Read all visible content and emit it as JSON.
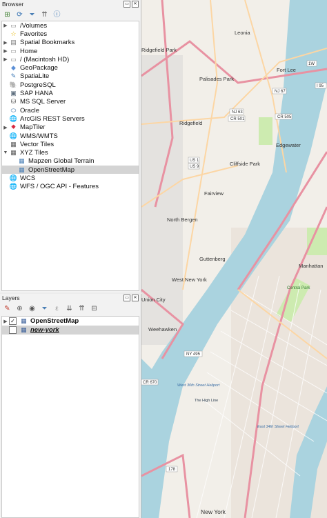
{
  "browser": {
    "title": "Browser",
    "toolbar_icons": [
      "add-layer-icon",
      "refresh-icon",
      "filter-icon",
      "collapse-icon",
      "info-icon"
    ],
    "items": [
      {
        "label": "/Volumes",
        "icon": "folder-icon",
        "expandable": true
      },
      {
        "label": "Favorites",
        "icon": "star-icon",
        "expandable": false
      },
      {
        "label": "Spatial Bookmarks",
        "icon": "bookmark-icon",
        "expandable": true
      },
      {
        "label": "Home",
        "icon": "folder-icon",
        "expandable": true
      },
      {
        "label": "/ (Macintosh HD)",
        "icon": "folder-icon",
        "expandable": true
      },
      {
        "label": "GeoPackage",
        "icon": "geopackage-icon",
        "expandable": false
      },
      {
        "label": "SpatiaLite",
        "icon": "spatialite-icon",
        "expandable": false
      },
      {
        "label": "PostgreSQL",
        "icon": "postgresql-icon",
        "expandable": false
      },
      {
        "label": "SAP HANA",
        "icon": "sap-hana-icon",
        "expandable": false
      },
      {
        "label": "MS SQL Server",
        "icon": "mssql-icon",
        "expandable": false
      },
      {
        "label": "Oracle",
        "icon": "oracle-icon",
        "expandable": false
      },
      {
        "label": "ArcGIS REST Servers",
        "icon": "arcgis-icon",
        "expandable": false
      },
      {
        "label": "MapTiler",
        "icon": "maptiler-icon",
        "expandable": true
      },
      {
        "label": "WMS/WMTS",
        "icon": "wms-icon",
        "expandable": false
      },
      {
        "label": "Vector Tiles",
        "icon": "vector-tiles-icon",
        "expandable": false
      },
      {
        "label": "XYZ Tiles",
        "icon": "xyz-tiles-icon",
        "expandable": true,
        "expanded": true
      },
      {
        "label": "Mapzen Global Terrain",
        "icon": "xyz-layer-icon",
        "child": true
      },
      {
        "label": "OpenStreetMap",
        "icon": "xyz-layer-icon",
        "child": true,
        "selected": true
      },
      {
        "label": "WCS",
        "icon": "wcs-icon",
        "expandable": false
      },
      {
        "label": "WFS / OGC API - Features",
        "icon": "wfs-icon",
        "expandable": false
      }
    ]
  },
  "layers": {
    "title": "Layers",
    "toolbar_icons": [
      "style-icon",
      "add-group-icon",
      "eye-icon",
      "filter-icon",
      "filter-expression-icon",
      "expand-all-icon",
      "collapse-all-icon",
      "remove-layer-icon"
    ],
    "items": [
      {
        "label": "OpenStreetMap",
        "checked": true,
        "icon": "raster-icon",
        "style": "bold"
      },
      {
        "label": "new-york",
        "checked": false,
        "icon": "grid-icon",
        "style": "italic-underline"
      }
    ]
  },
  "map": {
    "labels": {
      "leonia": "Leonia",
      "ridgefield_park": "Ridgefield Park",
      "palisades_park": "Palisades Park",
      "fort_lee": "Fort Lee",
      "ridgefield": "Ridgefield",
      "edgewater": "Edgewater",
      "cliffside_park": "Cliffside Park",
      "fairview": "Fairview",
      "north_bergen": "North Bergen",
      "guttenberg": "Guttenberg",
      "west_new_york": "West New York",
      "union_city": "Union City",
      "weehawken": "Weehawken",
      "manhattan": "Manhattan",
      "central_park": "Central Park",
      "the_high_line": "The High Line",
      "new_york": "New York",
      "w30_heliport": "West 30th Street Heliport",
      "e34_heliport": "East 34th Street Heliport"
    },
    "shields": {
      "nj63": "NJ 63",
      "cr501": "CR 501",
      "cr505": "CR 505",
      "nj67": "NJ 67",
      "us1": "US 1",
      "us9": "US 9",
      "ny495": "NY 495",
      "i78": "178",
      "cr670": "CR 670",
      "i1w": "1W",
      "i95": "I 95"
    },
    "colors": {
      "water": "#aad3df",
      "land": "#f2efe9",
      "park": "#cdebb0",
      "motorway": "#e892a2",
      "primary": "#fcd6a4",
      "urban": "#e0dfdf",
      "label": "#333333"
    }
  }
}
